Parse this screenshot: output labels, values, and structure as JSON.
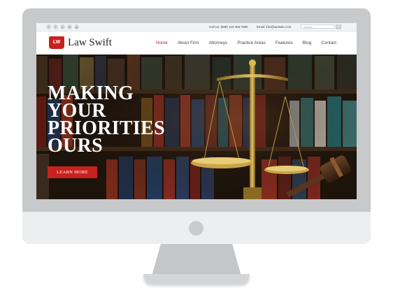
{
  "topbar": {
    "social_icons": [
      "facebook-icon",
      "twitter-icon",
      "pinterest-icon",
      "linkedin-icon",
      "instagram-icon"
    ],
    "social_glyphs": [
      "f",
      "t",
      "p",
      "in",
      "ig"
    ],
    "call_us": "Call Us: (888) 123-456-7890",
    "email": "Email: info@website.com",
    "search_placeholder": "Search...",
    "search_button_glyph": "⌕"
  },
  "brand": {
    "name": "Law Swift",
    "logo_glyph": "LW",
    "accent_color": "#c8211e"
  },
  "nav": {
    "items": [
      "Home",
      "About Firm",
      "Attorneys",
      "Practice Areas",
      "Features",
      "Blog",
      "Contact"
    ],
    "active": "Home"
  },
  "hero": {
    "heading_lines": [
      "MAKING",
      "YOUR",
      "PRIORITIES",
      "OURS"
    ],
    "cta_label": "LEARN MORE"
  }
}
